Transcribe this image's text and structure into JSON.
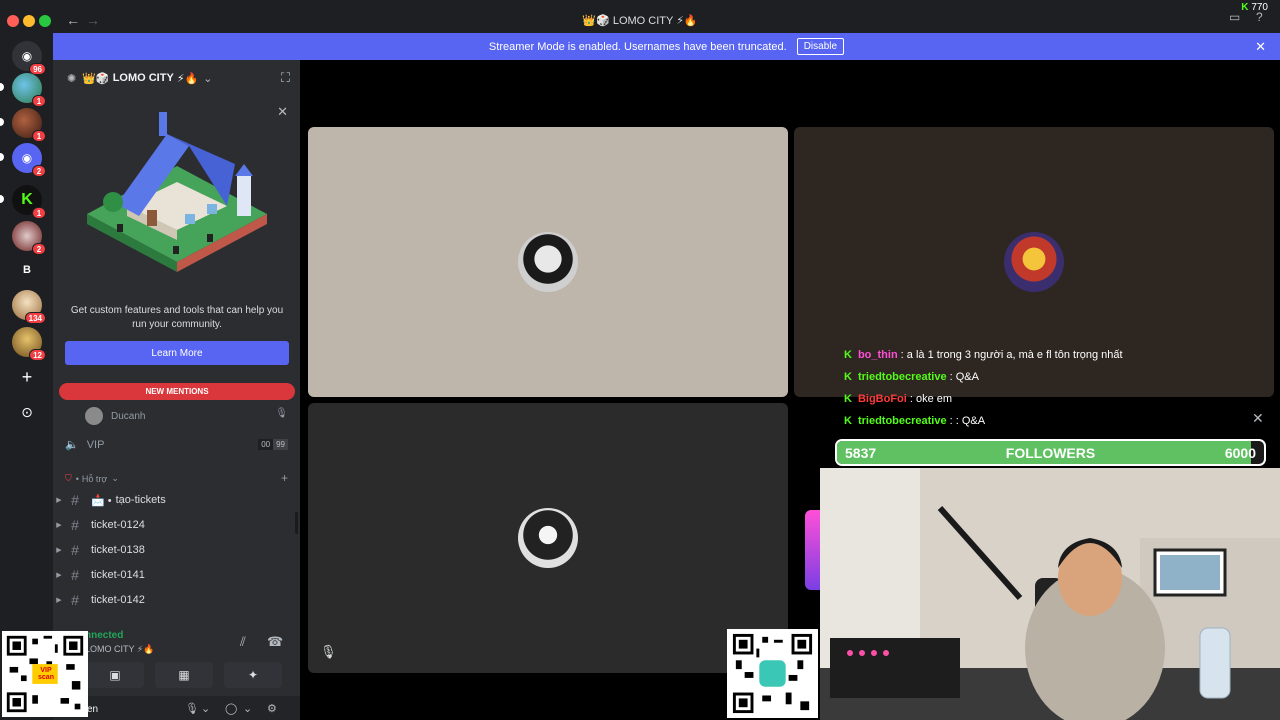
{
  "window": {
    "title": "LOMO CITY",
    "title_prefix_icons": "👑🎲",
    "title_suffix_icons": "⚡🔥",
    "counter": "770"
  },
  "guild_rail": {
    "items": [
      {
        "name": "discord-home",
        "badge": "96",
        "color": "#313338",
        "glyph": "◉"
      },
      {
        "name": "server-globe",
        "badge": "1",
        "color": "#3a8f5a",
        "glyph": ""
      },
      {
        "name": "server-warrior",
        "badge": "1",
        "color": "#7a3b2e",
        "glyph": ""
      },
      {
        "name": "server-discord",
        "badge": "2",
        "color": "#5865f2",
        "glyph": "◉"
      },
      {
        "name": "server-kick",
        "badge": "1",
        "color": "#53fc18",
        "glyph": "K"
      },
      {
        "name": "server-emblem",
        "badge": "2",
        "color": "#8c2a2a",
        "glyph": ""
      },
      {
        "name": "server-b",
        "badge": "",
        "color": "#313338",
        "glyph": "B"
      },
      {
        "name": "server-anime",
        "badge": "134",
        "color": "#c9a86a",
        "glyph": ""
      },
      {
        "name": "server-lomo",
        "badge": "12",
        "color": "#b08f3c",
        "glyph": ""
      }
    ],
    "add_server": "+",
    "explore": "⊙"
  },
  "banner": {
    "text": "Streamer Mode is enabled. Usernames have been truncated.",
    "button": "Disable",
    "bg": "#5865f2"
  },
  "sidebar": {
    "server_name": "LOMO CITY",
    "server_prefix": "👑🎲",
    "server_suffix": "⚡🔥",
    "promo_text": "Get custom features and tools that can help you run your community.",
    "learn_more": "Learn More",
    "new_mentions": "NEW MENTIONS",
    "voice_user": "Ducanh",
    "vip_channel": "VIP",
    "vip_count_a": "00",
    "vip_count_b": "99",
    "category": "Hỗ trợ",
    "channels": [
      {
        "label": "tạo-tickets",
        "prefix": "📩 •"
      },
      {
        "label": "ticket-0124",
        "prefix": ""
      },
      {
        "label": "ticket-0138",
        "prefix": ""
      },
      {
        "label": "ticket-0141",
        "prefix": ""
      },
      {
        "label": "ticket-0142",
        "prefix": ""
      }
    ],
    "voice_status": "nnected",
    "voice_server": "LOMO CITY ⚡🔥",
    "user_name": "en"
  },
  "chat": [
    {
      "user": "bo_thin",
      "message": ": a là 1 trong 3 người a, mà e fl tôn trọng nhất",
      "color": "#ff4fd8"
    },
    {
      "user": "triedtobecreative",
      "message": ": Q&A",
      "color": "#53fc18"
    },
    {
      "user": "BigBoFoi",
      "message": ": oke em",
      "color": "#ff3b3b"
    },
    {
      "user": "triedtobecreative",
      "message": ": : Q&A",
      "color": "#53fc18"
    }
  ],
  "followers": {
    "current": "5837",
    "label": "FOLLOWERS",
    "goal": "6000",
    "progress": 0.97,
    "fill_color": "#5fc161"
  },
  "qr": {
    "left_label": "VIP scan"
  }
}
